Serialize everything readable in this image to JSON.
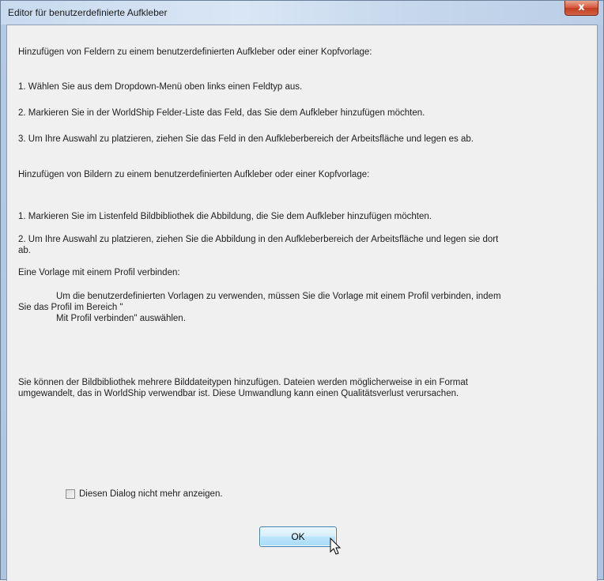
{
  "window": {
    "title": "Editor für benutzerdefinierte Aufkleber",
    "close_label": "x"
  },
  "content": {
    "fields_heading": "Hinzufügen von Feldern zu einem benutzerdefinierten Aufkleber oder einer Kopfvorlage:",
    "fields_step1": "1. Wählen Sie aus dem Dropdown-Menü oben links einen Feldtyp aus.",
    "fields_step2": "2. Markieren Sie in der WorldShip Felder-Liste das Feld, das Sie dem Aufkleber hinzufügen möchten.",
    "fields_step3": "3. Um Ihre Auswahl zu platzieren, ziehen Sie das Feld in den Aufkleberbereich der Arbeitsfläche und legen es ab.",
    "images_heading": "Hinzufügen von Bildern zu einem benutzerdefinierten Aufkleber oder einer Kopfvorlage:",
    "images_step1": "1. Markieren Sie im Listenfeld Bildbibliothek die Abbildung, die Sie dem Aufkleber hinzufügen möchten.",
    "images_step2_line1": "2. Um Ihre Auswahl zu platzieren, ziehen Sie die Abbildung in den Aufkleberbereich der Arbeitsfläche und legen sie dort",
    "images_step2_line2": "ab.",
    "profile_heading": "Eine Vorlage mit einem Profil verbinden:",
    "profile_line1": "Um die benutzerdefinierten Vorlagen zu verwenden, müssen Sie die Vorlage mit einem Profil verbinden, indem",
    "profile_line2": "Sie das Profil im Bereich \"",
    "profile_line3": "Mit Profil verbinden\" auswählen.",
    "library_line1": "Sie können der Bildbibliothek mehrere Bilddateitypen hinzufügen. Dateien werden möglicherweise in ein Format",
    "library_line2": "umgewandelt, das in WorldShip verwendbar ist. Diese Umwandlung kann einen Qualitätsverlust verursachen."
  },
  "footer": {
    "checkbox_label": "Diesen Dialog nicht mehr anzeigen.",
    "checkbox_checked": false,
    "ok_label": "OK"
  }
}
